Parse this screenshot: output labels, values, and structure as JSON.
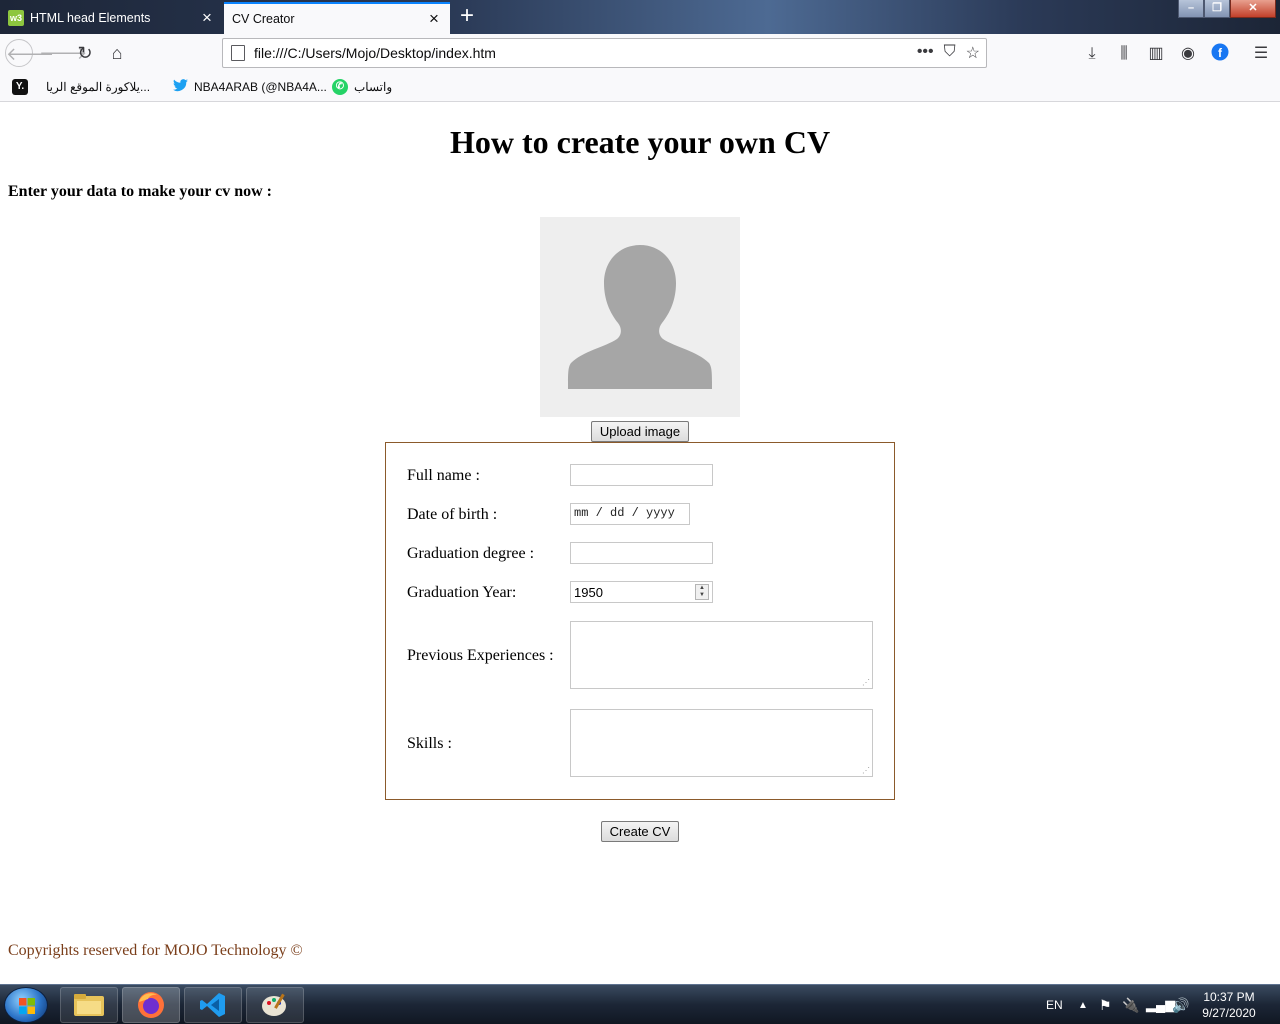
{
  "browser": {
    "tabs": [
      {
        "title": "HTML head Elements",
        "favicon": "w3"
      },
      {
        "title": "CV Creator"
      }
    ],
    "url": "file:///C:/Users/Mojo/Desktop/index.htm",
    "bookmarks": [
      {
        "label": "يلاكورة الموقع الريا..."
      },
      {
        "label": "NBA4ARAB (@NBA4A..."
      },
      {
        "label": "واتساب"
      }
    ]
  },
  "page": {
    "title": "How to create your own CV",
    "intro": "Enter your data to make your cv now :",
    "upload_label": "Upload image",
    "form": {
      "full_name_label": "Full name :",
      "dob_label": "Date of birth :",
      "dob_placeholder": "mm / dd / yyyy",
      "degree_label": "Graduation degree :",
      "year_label": "Graduation Year:",
      "year_value": "1950",
      "experiences_label": "Previous Experiences :",
      "skills_label": "Skills :"
    },
    "create_label": "Create CV",
    "footer": "Copyrights reserved for MOJO Technology ©"
  },
  "taskbar": {
    "language": "EN",
    "time": "10:37 PM",
    "date": "9/27/2020"
  },
  "colors": {
    "form_border": "#8b5a2b",
    "footer_text": "#7a3e1a",
    "active_tab_accent": "#0a84ff"
  }
}
